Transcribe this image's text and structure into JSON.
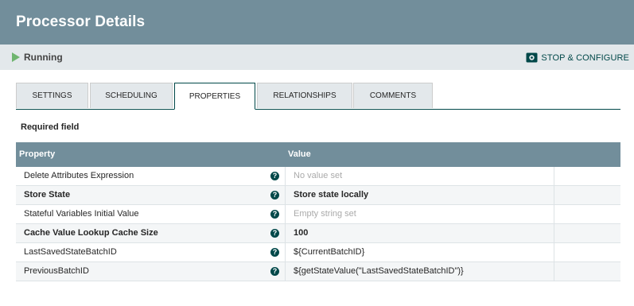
{
  "dialog": {
    "title": "Processor Details"
  },
  "status": {
    "state": "Running",
    "stop_configure_label": "STOP & CONFIGURE"
  },
  "tabs": [
    {
      "label": "SETTINGS"
    },
    {
      "label": "SCHEDULING"
    },
    {
      "label": "PROPERTIES",
      "active": true
    },
    {
      "label": "RELATIONSHIPS"
    },
    {
      "label": "COMMENTS"
    }
  ],
  "required_field_label": "Required field",
  "grid": {
    "headers": {
      "property": "Property",
      "value": "Value"
    },
    "rows": [
      {
        "name": "Delete Attributes Expression",
        "value": "No value set",
        "required": false,
        "unset": true
      },
      {
        "name": "Store State",
        "value": "Store state locally",
        "required": true,
        "unset": false
      },
      {
        "name": "Stateful Variables Initial Value",
        "value": "Empty string set",
        "required": false,
        "unset": true
      },
      {
        "name": "Cache Value Lookup Cache Size",
        "value": "100",
        "required": true,
        "unset": false
      },
      {
        "name": "LastSavedStateBatchID",
        "value": "${CurrentBatchID}",
        "required": false,
        "unset": false
      },
      {
        "name": "PreviousBatchID",
        "value": "${getStateValue(\"LastSavedStateBatchID\")}",
        "required": false,
        "unset": false
      }
    ]
  },
  "icons": {
    "status": "play-icon",
    "stop_configure": "stop-configure-icon",
    "help": "help-icon"
  },
  "colors": {
    "header": "#728e9b",
    "accent": "#004849",
    "running": "#6fb56f"
  }
}
